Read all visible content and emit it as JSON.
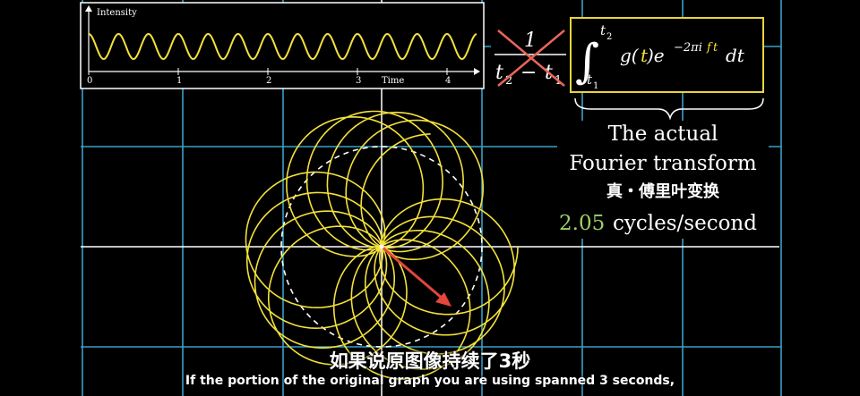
{
  "graph": {
    "ylabel": "Intensity",
    "xlabel": "Time",
    "ticks": [
      "0",
      "1",
      "2",
      "3",
      "4"
    ]
  },
  "formula": {
    "fraction_numerator": "1",
    "t2": "t",
    "t2_sub": "2",
    "minus": "−",
    "t1": "t",
    "t1_sub": "1",
    "integral": "∫",
    "int_upper": "t",
    "int_upper_sub": "2",
    "int_lower": "t",
    "int_lower_sub": "1",
    "g": "g(",
    "t": "t",
    "close_e": ")e",
    "exp_prefix": "−2πi",
    "exp_f": "f",
    "exp_t": "t",
    "dt": "dt"
  },
  "caption": {
    "line1": "The actual",
    "line2": "Fourier transform",
    "line3_cn": "真・傅里叶变换",
    "freq_value": "2.05",
    "freq_unit": "cycles/second"
  },
  "subtitles": {
    "cn": "如果说原图像持续了3秒",
    "en": "If the portion of the original graph you are using spanned 3 seconds,"
  },
  "colors": {
    "wave": "#f3e13c",
    "grid": "#3aa0c8",
    "arrow": "#e4463b",
    "freq": "#9dcf6b",
    "cross": "#e8655a",
    "box": "#e8d63a"
  }
}
